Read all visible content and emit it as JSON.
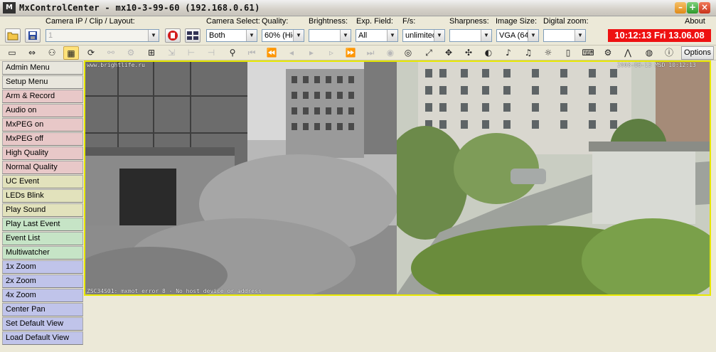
{
  "window": {
    "title": "MxControlCenter - mx10-3-99-60 (192.168.0.61)",
    "logo": "M"
  },
  "menu": {
    "about": "About"
  },
  "labels": {
    "camera_ip": "Camera IP / Clip / Layout:",
    "camera_select": "Camera Select:",
    "quality": "Quality:",
    "brightness": "Brightness:",
    "exp_field": "Exp. Field:",
    "fps": "F/s:",
    "sharpness": "Sharpness:",
    "image_size": "Image Size:",
    "digital_zoom": "Digital zoom:"
  },
  "controls": {
    "camera_ip_value": "1",
    "camera_select_value": "Both",
    "quality_value": "60% (Hig",
    "brightness_value": "",
    "exp_field_value": "All",
    "fps_value": "unlimited",
    "sharpness_value": "",
    "image_size_value": "VGA (64",
    "digital_zoom_value": ""
  },
  "clock": "10:12:13 Fri 13.06.08",
  "clock_color": "#ee1111",
  "toolbar": {
    "options_label": "Options"
  },
  "sidebar": {
    "items": [
      {
        "label": "Admin Menu",
        "color": "#e8e6dd"
      },
      {
        "label": "Setup Menu",
        "color": "#e8e6dd"
      },
      {
        "label": "Arm & Record",
        "color": "#e8c8c8"
      },
      {
        "label": "Audio on",
        "color": "#e8c8c8"
      },
      {
        "label": "MxPEG on",
        "color": "#e8c8c8"
      },
      {
        "label": "MxPEG off",
        "color": "#e8c8c8"
      },
      {
        "label": "High Quality",
        "color": "#e8c8c8"
      },
      {
        "label": "Normal Quality",
        "color": "#e8c8c8"
      },
      {
        "label": "UC Event",
        "color": "#e2e2bc"
      },
      {
        "label": "LEDs Blink",
        "color": "#e2e2bc"
      },
      {
        "label": "Play Sound",
        "color": "#e2e2bc"
      },
      {
        "label": "Play Last Event",
        "color": "#c6e4c6"
      },
      {
        "label": "Event List",
        "color": "#c6e4c6"
      },
      {
        "label": "Multiwatcher",
        "color": "#c6e4c6"
      },
      {
        "label": "1x Zoom",
        "color": "#c0c4ea"
      },
      {
        "label": "2x Zoom",
        "color": "#c0c4ea"
      },
      {
        "label": "4x Zoom",
        "color": "#c0c4ea"
      },
      {
        "label": "Center Pan",
        "color": "#c0c4ea"
      },
      {
        "label": "Set Default View",
        "color": "#c0c4ea"
      },
      {
        "label": "Load Default View",
        "color": "#c0c4ea"
      }
    ]
  },
  "video": {
    "osd_left_top": "www.brightlife.ru",
    "osd_right_top": "2008-06-13 MSD 10:12:13",
    "osd_bottom": "ZSC34S01: mxmot error 8 - No host device or address",
    "border_color": "#e8e800"
  }
}
